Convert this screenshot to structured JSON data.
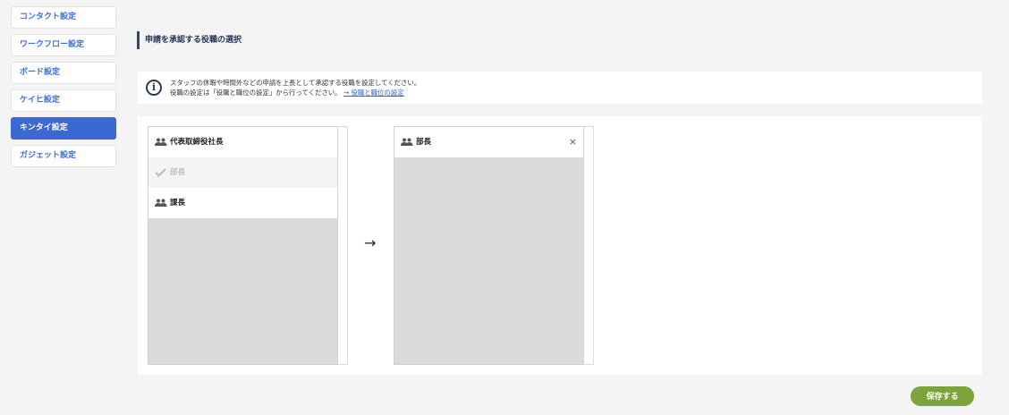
{
  "sidebar": {
    "items": [
      {
        "label": "コンタクト設定"
      },
      {
        "label": "ワークフロー設定"
      },
      {
        "label": "ボード設定"
      },
      {
        "label": "ケイヒ設定"
      },
      {
        "label": "キンタイ設定",
        "active": true
      },
      {
        "label": "ガジェット設定"
      }
    ]
  },
  "section": {
    "title": "申請を承認する役職の選択"
  },
  "info": {
    "line1": "スタッフの休暇や時間外などの申請を上長として承認する役職を設定してください。",
    "line2": "役職の設定は「役職と職位の設定」から行ってください。",
    "link": "→ 役職と職位の設定"
  },
  "available": {
    "items": [
      {
        "label": "代表取締役社長",
        "icon": "users-icon"
      },
      {
        "label": "部長",
        "icon": "check-icon",
        "disabled": true
      },
      {
        "label": "課長",
        "icon": "users-icon"
      }
    ]
  },
  "arrow": "→",
  "selected": {
    "items": [
      {
        "label": "部長",
        "icon": "users-icon",
        "remove": "×"
      }
    ]
  },
  "actions": {
    "save_label": "保存する"
  },
  "colors": {
    "accent": "#3b69d1",
    "save": "#7ca43a",
    "link": "#2f63c8"
  }
}
